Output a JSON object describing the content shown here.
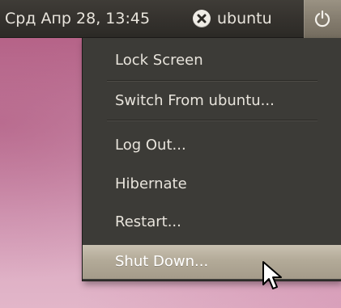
{
  "panel": {
    "clock": "Срд Апр 28, 13:45",
    "status_icon": "user-offline-icon",
    "username": "ubuntu",
    "session_icon": "power-icon"
  },
  "session_menu": {
    "items": [
      {
        "label": "Lock Screen",
        "highlighted": false
      },
      {
        "label": "Switch From ubuntu...",
        "highlighted": false
      },
      {
        "label": "Log Out...",
        "highlighted": false
      },
      {
        "label": "Hibernate",
        "highlighted": false
      },
      {
        "label": "Restart...",
        "highlighted": false
      },
      {
        "label": "Shut Down...",
        "highlighted": true
      }
    ]
  },
  "colors": {
    "panel_bg": "#35322e",
    "menu_bg": "#3c3b37",
    "highlight": "#b3aa98",
    "text": "#e8e4dc",
    "session_button": "#857d6f"
  }
}
